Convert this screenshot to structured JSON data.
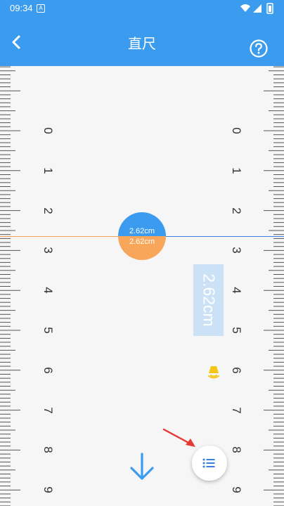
{
  "status_bar": {
    "time": "09:34",
    "notification_glyph": "A"
  },
  "app_bar": {
    "title": "直尺"
  },
  "ruler": {
    "labels": [
      "0",
      "1",
      "2",
      "3",
      "4",
      "5",
      "6",
      "7",
      "8",
      "9"
    ]
  },
  "measurement": {
    "top_value": "2.62cm",
    "bottom_value": "2.62cm",
    "vertical_value": "2.62cm"
  },
  "colors": {
    "primary": "#3a9bef",
    "accent_orange": "#f8a65a",
    "bell": "#f5c518",
    "hint_arrow": "#e53935"
  },
  "icons": {
    "back": "chevron-left-icon",
    "help": "question-circle-icon",
    "bell": "bell-icon",
    "down": "arrow-down-icon",
    "menu": "list-icon",
    "hint": "red-arrow-icon"
  }
}
